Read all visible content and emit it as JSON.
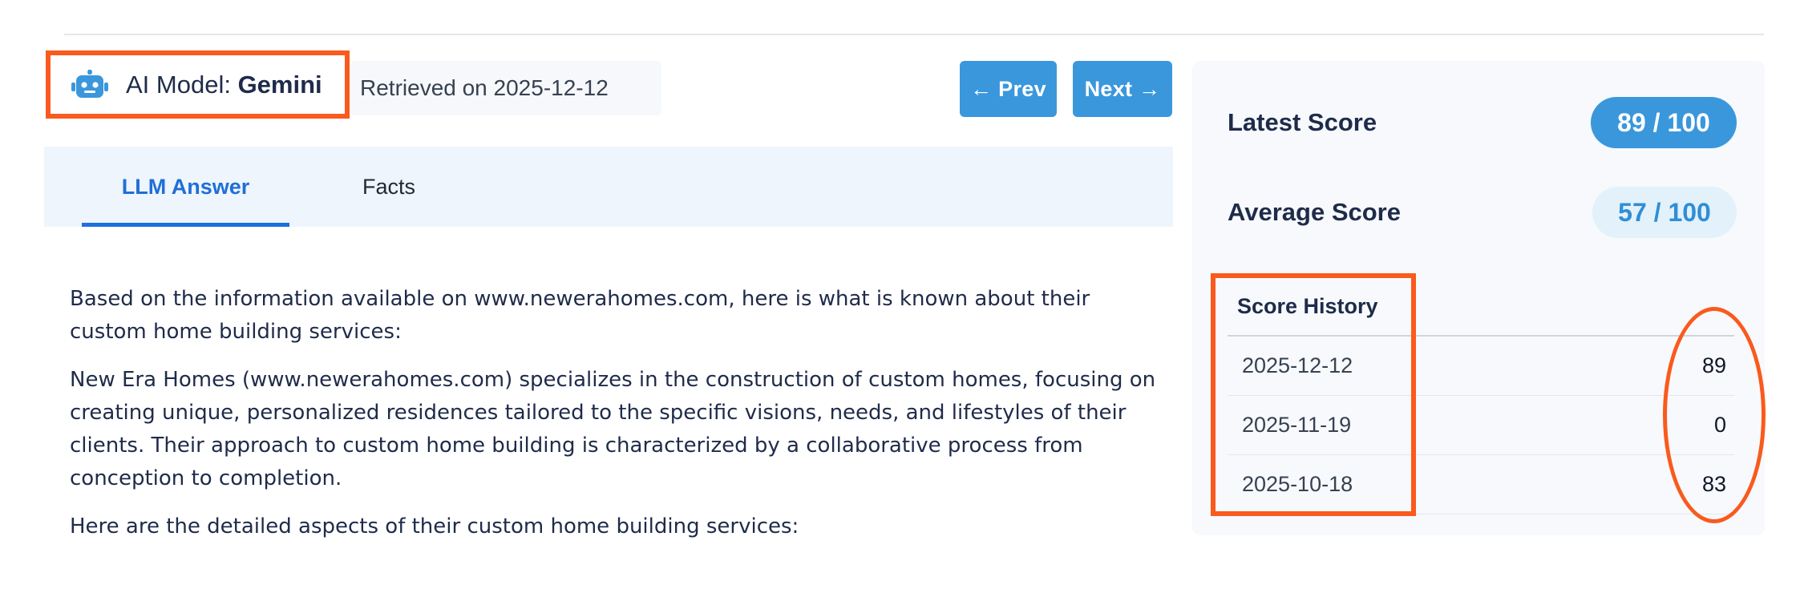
{
  "header": {
    "model_label": "AI Model: ",
    "model_name": "Gemini",
    "model_icon": "robot-icon",
    "retrieved": "Retrieved on 2025-12-12",
    "prev_label": "← Prev",
    "next_label": "Next →"
  },
  "tabs": [
    {
      "label": "LLM Answer",
      "active": true
    },
    {
      "label": "Facts",
      "active": false
    }
  ],
  "answer": {
    "paragraphs": [
      "Based on the information available on www.newerahomes.com, here is what is known about their custom home building services:",
      "New Era Homes (www.newerahomes.com) specializes in the construction of custom homes, focusing on creating unique, personalized residences tailored to the specific visions, needs, and lifestyles of their clients. Their approach to custom home building is characterized by a collaborative process from conception to completion.",
      "Here are the detailed aspects of their custom home building services:"
    ]
  },
  "scores": {
    "latest_label": "Latest Score",
    "latest_value": "89 / 100",
    "average_label": "Average Score",
    "average_value": "57 / 100",
    "history_title": "Score History",
    "history": [
      {
        "date": "2025-12-12",
        "score": "89"
      },
      {
        "date": "2025-11-19",
        "score": "0"
      },
      {
        "date": "2025-10-18",
        "score": "83"
      }
    ]
  },
  "colors": {
    "accent": "#3a97dc",
    "highlight": "#fa5a1d",
    "active_tab": "#1f6fd6"
  }
}
